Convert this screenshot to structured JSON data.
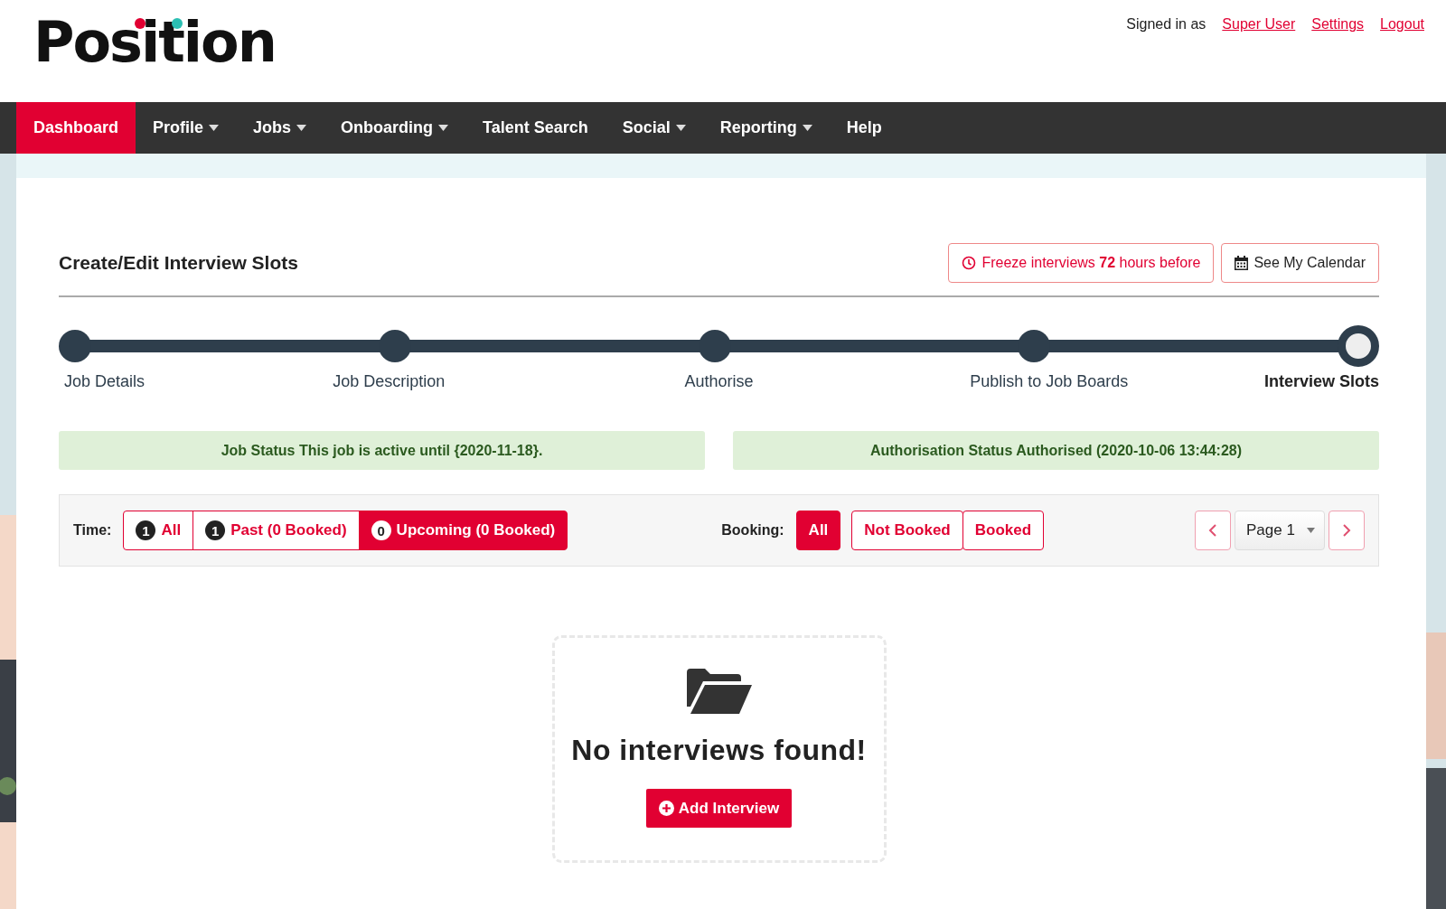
{
  "logo": {
    "text": "Position"
  },
  "account": {
    "signed_in_label": "Signed in as",
    "links": [
      "Super User",
      "Settings",
      "Logout"
    ]
  },
  "nav": [
    {
      "label": "Dashboard",
      "selected": true,
      "dropdown": false
    },
    {
      "label": "Profile",
      "selected": false,
      "dropdown": true
    },
    {
      "label": "Jobs",
      "selected": false,
      "dropdown": true
    },
    {
      "label": "Onboarding",
      "selected": false,
      "dropdown": true
    },
    {
      "label": "Talent Search",
      "selected": false,
      "dropdown": false
    },
    {
      "label": "Social",
      "selected": false,
      "dropdown": true
    },
    {
      "label": "Reporting",
      "selected": false,
      "dropdown": true
    },
    {
      "label": "Help",
      "selected": false,
      "dropdown": false
    }
  ],
  "page": {
    "title": "Create/Edit Interview Slots",
    "freeze_button": "Freeze interviews **72** hours before",
    "calendar_button": "See My Calendar"
  },
  "steps": [
    {
      "label": "Job Details",
      "selected": false
    },
    {
      "label": "Job Description",
      "selected": false
    },
    {
      "label": "Authorise",
      "selected": false
    },
    {
      "label": "Publish to Job Boards",
      "selected": false
    },
    {
      "label": "Interview Slots",
      "selected": true
    }
  ],
  "status": [
    "Job Status This job is active until {2020-11-18}.",
    "Authorisation Status Authorised (2020-10-06 13:44:28)"
  ],
  "filters": {
    "time_label": "Time:",
    "time": [
      {
        "count": "1",
        "label": "All",
        "selected": false
      },
      {
        "count": "1",
        "label": "Past (0 Booked)",
        "selected": false
      },
      {
        "count": "0",
        "label": "Upcoming (0 Booked)",
        "selected": true
      }
    ],
    "booking_label": "Booking:",
    "booking": [
      {
        "label": "All",
        "selected": true
      },
      {
        "label": "Not Booked",
        "selected": false
      },
      {
        "label": "Booked",
        "selected": false
      }
    ],
    "page_select": "Page 1"
  },
  "empty": {
    "message": "No interviews found!",
    "button": "Add Interview"
  }
}
